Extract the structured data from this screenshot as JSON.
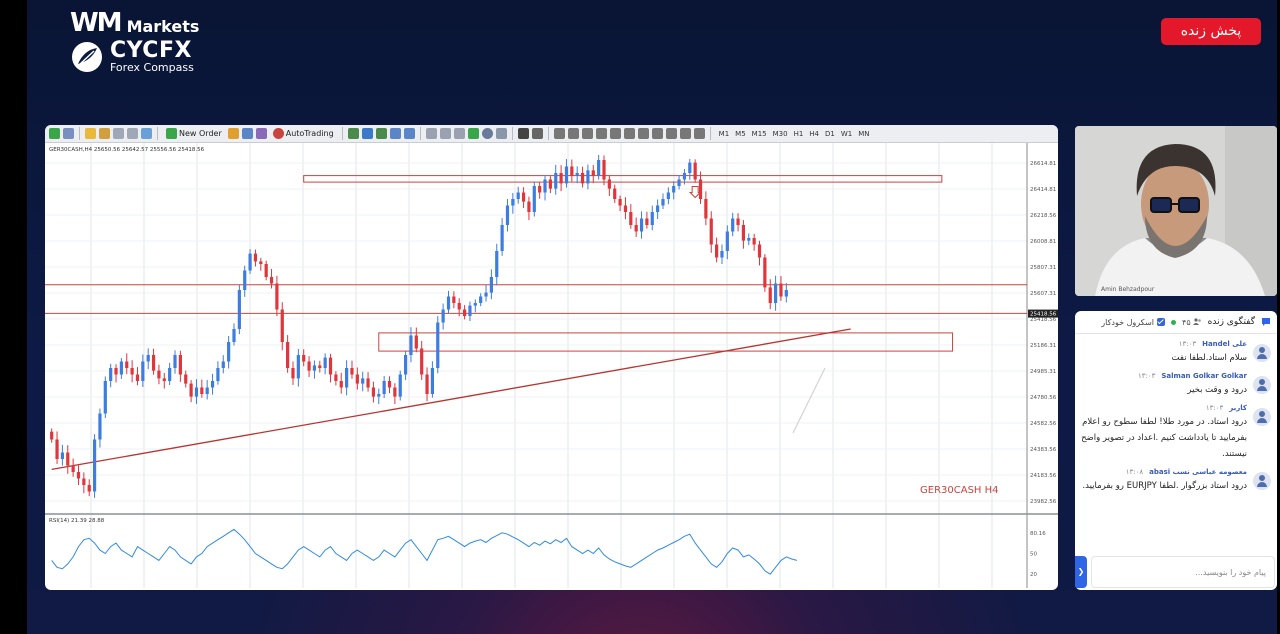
{
  "branding": {
    "wm_mark": "WM",
    "wm_text": "Markets",
    "cycfx_name": "CYCFX",
    "cycfx_tagline": "Forex Compass"
  },
  "live_badge": {
    "label": "پخش زنده",
    "color": "#e3182a"
  },
  "toolbar": {
    "new_order_label": "New Order",
    "autotrading_label": "AutoTrading",
    "timeframes": [
      "M1",
      "M5",
      "M15",
      "M30",
      "H1",
      "H4",
      "D1",
      "W1",
      "MN"
    ]
  },
  "chart_data": {
    "type": "candlestick",
    "symbol_label": "GER30CASH H4",
    "header_text": "GER30CASH,H4  25650.56 25642.57 25556.56 25418.56",
    "price_axis_labels": [
      "26614.81",
      "26414.81",
      "26218.56",
      "26008.81",
      "25807.31",
      "25607.31",
      "25418.56",
      "25186.31",
      "24985.31",
      "24780.56",
      "24582.56",
      "24383.56",
      "24183.56",
      "23982.56"
    ],
    "current_price": "25418.56",
    "ylim": [
      23900,
      26700
    ],
    "closes": [
      24450,
      24300,
      24350,
      24250,
      24200,
      24150,
      24100,
      24050,
      24450,
      24650,
      24900,
      25000,
      24950,
      25050,
      25000,
      24950,
      24900,
      25050,
      25100,
      24980,
      24920,
      24900,
      25000,
      25100,
      24950,
      24880,
      24780,
      24850,
      24800,
      24850,
      24900,
      25000,
      25050,
      25200,
      25300,
      25600,
      25750,
      25880,
      25820,
      25800,
      25700,
      25650,
      25450,
      25200,
      25000,
      24920,
      25100,
      25050,
      24980,
      25020,
      25000,
      25080,
      24950,
      24900,
      24850,
      25000,
      24950,
      24880,
      24920,
      24850,
      24780,
      24800,
      24900,
      24850,
      24780,
      24950,
      25100,
      25250,
      25150,
      24950,
      24800,
      25000,
      25350,
      25450,
      25550,
      25500,
      25450,
      25400,
      25480,
      25500,
      25550,
      25580,
      25700,
      25900,
      26100,
      26250,
      26300,
      26350,
      26280,
      26200,
      26400,
      26350,
      26450,
      26380,
      26500,
      26420,
      26550,
      26480,
      26500,
      26420,
      26520,
      26480,
      26600,
      26450,
      26380,
      26300,
      26250,
      26200,
      26100,
      26050,
      26150,
      26100,
      26200,
      26250,
      26300,
      26350,
      26400,
      26450,
      26500,
      26580,
      26450,
      26300,
      26150,
      25950,
      25850,
      25900,
      26050,
      26150,
      26100,
      25980,
      26000,
      25950,
      25850,
      25620,
      25500,
      25650,
      25550,
      25600
    ],
    "annotations": [
      {
        "kind": "rectangle",
        "price_top": 26480,
        "price_bottom": 26430,
        "bar_start": 47,
        "bar_end": 166
      },
      {
        "kind": "hline",
        "price": 25640
      },
      {
        "kind": "hline",
        "price": 25420
      },
      {
        "kind": "rectangle",
        "price_top": 25270,
        "price_bottom": 25130,
        "bar_start": 61,
        "bar_end": 168
      },
      {
        "kind": "trendline",
        "price_start": 24220,
        "bar_start": 0,
        "price_end": 25300,
        "bar_end": 149
      },
      {
        "kind": "arrow",
        "direction": "down",
        "price": 26350,
        "bar": 120
      }
    ],
    "indicator": {
      "header_text": "RSI(14) 21.39 28.88",
      "ylim": [
        0,
        100
      ],
      "axis_labels": [
        "80.16",
        "50",
        "20"
      ],
      "values": [
        40,
        30,
        28,
        35,
        45,
        60,
        70,
        72,
        65,
        55,
        50,
        60,
        65,
        55,
        50,
        45,
        60,
        55,
        50,
        45,
        40,
        50,
        60,
        55,
        45,
        40,
        35,
        45,
        50,
        60,
        65,
        70,
        75,
        80,
        85,
        78,
        70,
        60,
        50,
        45,
        40,
        35,
        30,
        28,
        35,
        45,
        55,
        60,
        55,
        50,
        45,
        55,
        60,
        50,
        45,
        40,
        50,
        55,
        50,
        45,
        40,
        45,
        55,
        50,
        45,
        55,
        65,
        70,
        60,
        50,
        40,
        55,
        70,
        72,
        75,
        70,
        65,
        60,
        65,
        68,
        70,
        66,
        72,
        76,
        80,
        78,
        74,
        70,
        65,
        60,
        66,
        62,
        68,
        64,
        70,
        66,
        72,
        60,
        55,
        50,
        55,
        50,
        58,
        48,
        42,
        38,
        35,
        32,
        30,
        35,
        40,
        45,
        50,
        55,
        58,
        62,
        66,
        70,
        75,
        78,
        65,
        55,
        45,
        35,
        30,
        38,
        50,
        58,
        55,
        45,
        48,
        42,
        35,
        25,
        20,
        30,
        40,
        45,
        42,
        40
      ]
    },
    "colors": {
      "up": "#3d7de0",
      "down": "#e0353b",
      "annotation": "#c8453f",
      "trendline": "#b8342f",
      "indicator_line": "#2f8ce0",
      "symbol_label": "#c8453f"
    }
  },
  "webcam": {
    "name": "Amin Behzadpour"
  },
  "chat": {
    "title": "گفتگوی زنده",
    "count": "۴۵",
    "scroll_label": "اسکرول خودکار",
    "messages": [
      {
        "name": "علی Handel",
        "time": "۱۳:۰۳",
        "text": "سلام استاد.لطفا نفت"
      },
      {
        "name": "Salman Golkar Golkar",
        "time": "۱۳:۰۳",
        "text": "درود و وقت بخیر"
      },
      {
        "name": "کاربر",
        "time": "۱۳:۰۳",
        "text": "درود استاد. در مورد طلا! لطفا سطوح رو اعلام بفرمایید تا یادداشت کنیم .اعداد در تصویر واضح نیستند."
      },
      {
        "name": "معصومه عباسی نسب abasi",
        "time": "۱۳:۰۸",
        "text": "درود استاد بزرگوار .لطفا EURJPY رو بفرمایید."
      }
    ],
    "input_placeholder": "پیام خود را بنویسید..."
  }
}
